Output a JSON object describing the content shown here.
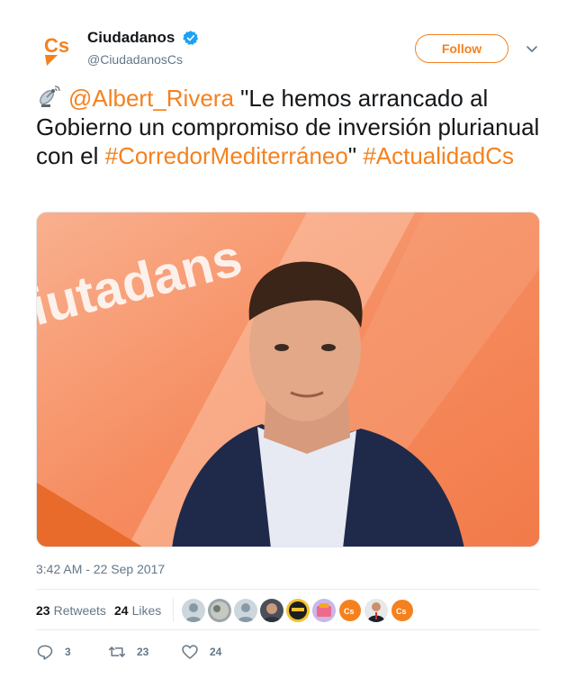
{
  "tweet": {
    "author": {
      "display_name": "Ciudadanos",
      "handle": "@CiudadanosCs",
      "verified": true,
      "logo_text": "Cs"
    },
    "follow_label": "Follow",
    "text": {
      "mention": "@Albert_Rivera",
      "quote": " \"Le hemos arrancado al Gobierno un compromiso de inversión plurianual con el ",
      "hashtag1": "#CorredorMediterráneo",
      "quote_end": "\" ",
      "hashtag2": "#ActualidadCs"
    },
    "media": {
      "banner_text": "iutadans"
    },
    "timestamp": "3:42 AM - 22 Sep 2017",
    "stats": {
      "retweets_count": "23",
      "retweets_label": "Retweets",
      "likes_count": "24",
      "likes_label": "Likes"
    },
    "actions": {
      "reply_count": "3",
      "retweet_count": "23",
      "like_count": "24"
    }
  },
  "colors": {
    "brand_orange": "#f5811e",
    "text_secondary": "#657786",
    "verified_blue": "#1da1f2"
  }
}
